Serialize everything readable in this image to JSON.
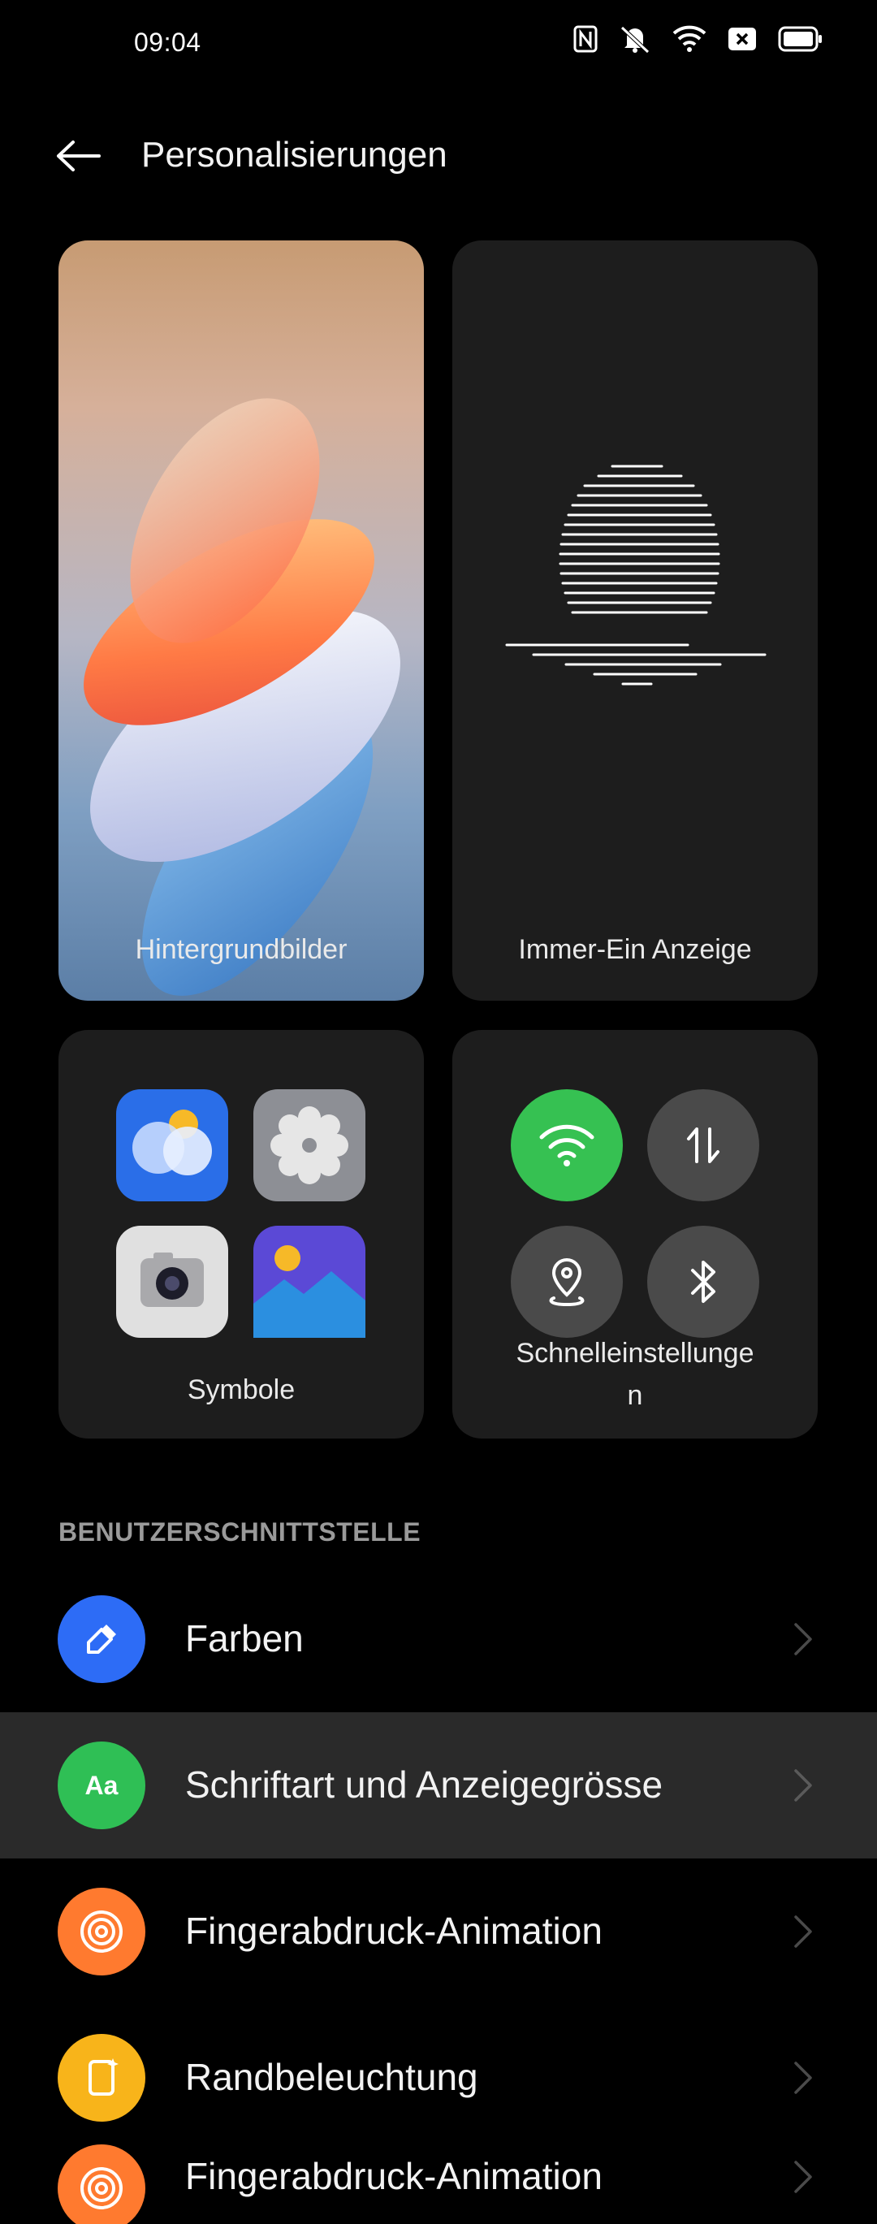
{
  "status_bar": {
    "time": "09:04",
    "icons": [
      "nfc-icon",
      "mute-icon",
      "wifi-icon",
      "close-box-icon",
      "battery-icon"
    ]
  },
  "header": {
    "title": "Personalisierungen"
  },
  "cards": {
    "wallpaper": "Hintergrundbilder",
    "always_on": "Immer-Ein Anzeige",
    "icons": "Symbole",
    "quick_settings_line1": "Schnelleinstellunge",
    "quick_settings_line2": "n"
  },
  "section_title": "BENUTZERSCHNITTSTELLE",
  "menu": [
    {
      "label": "Farben",
      "color": "#2d6cf6",
      "icon": "pen-icon"
    },
    {
      "label": "Schriftart und Anzeigegrösse",
      "color": "#2fbf55",
      "icon": "font-icon"
    },
    {
      "label": "Fingerabdruck-Animation",
      "color": "#ff7a2f",
      "icon": "fingerprint-icon"
    },
    {
      "label": "Randbeleuchtung",
      "color": "#f8b41a",
      "icon": "edge-light-icon"
    },
    {
      "label": "Fingerabdruck-Animation",
      "color": "#ff7a2f",
      "icon": "fingerprint-icon"
    }
  ],
  "colors": {
    "accent_green": "#36c152",
    "selected_row": "#2a2a2a"
  }
}
